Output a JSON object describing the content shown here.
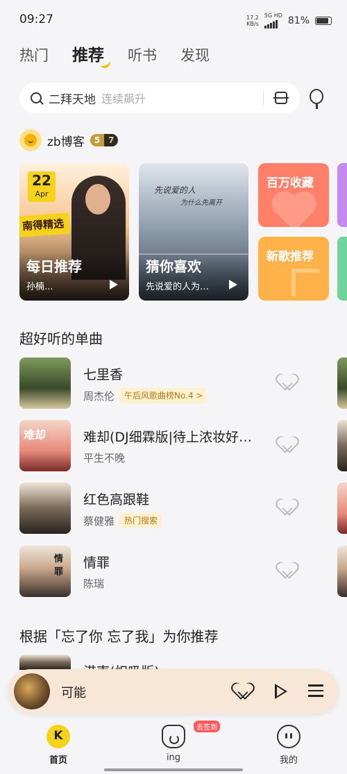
{
  "status_bar": {
    "time": "09:27",
    "net_speed": "17.2",
    "net_unit": "KB/s",
    "net_type": "5G HD",
    "battery": "81%"
  },
  "tabs": [
    "热门",
    "推荐",
    "听书",
    "发现"
  ],
  "search": {
    "query": "二拜天地",
    "hint": "连续飙升"
  },
  "user": {
    "name": "zb博客",
    "vip_level": "5",
    "vip_rank": "7"
  },
  "cards": {
    "daily": {
      "date_day": "22",
      "date_month": "Apr",
      "cover_text": "南得精选",
      "title": "每日推荐",
      "subtitle": "孙楠..."
    },
    "guess": {
      "script_line1": "先说爱的人",
      "script_line2": "为什么先离开",
      "title": "猜你喜欢",
      "subtitle": "先说爱的人为…"
    },
    "tiles": [
      "百万收藏",
      "新歌推荐"
    ]
  },
  "section_singles": {
    "title": "超好听的单曲",
    "songs": [
      {
        "title": "七里香",
        "artist": "周杰伦",
        "tag": "午后风歌曲榜No.4 >"
      },
      {
        "title": "难却(DJ细霖版|待上浓妆好…",
        "artist": "平生不晚",
        "tag": "",
        "cover_label": "难却"
      },
      {
        "title": "红色高跟鞋",
        "artist": "蔡健雅",
        "tag": "热门搜索"
      },
      {
        "title": "情罪",
        "artist": "陈瑞",
        "tag": "",
        "cover_label": "情罪"
      }
    ]
  },
  "section_recommend": {
    "title": "根据「忘了你 忘了我」为你推荐",
    "partial_song": "港南(炽吸版)"
  },
  "player": {
    "title": "可能"
  },
  "nav": {
    "home": {
      "label": "首页",
      "icon_char": "K"
    },
    "ing": {
      "label": "ing",
      "badge": "去签到"
    },
    "me": {
      "label": "我的"
    }
  }
}
